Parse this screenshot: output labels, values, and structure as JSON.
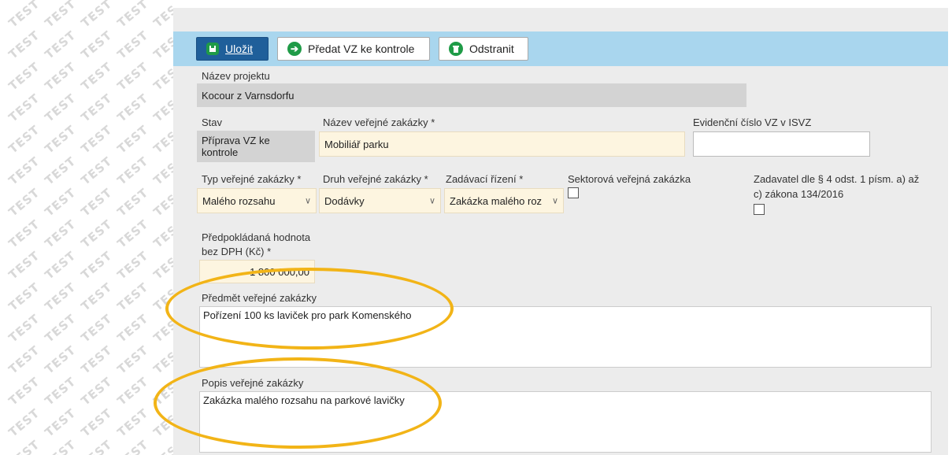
{
  "watermark": {
    "text": "TEST"
  },
  "toolbar": {
    "save_label": "Uložit",
    "submit_label": "Předat VZ ke kontrole",
    "delete_label": "Odstranit"
  },
  "form": {
    "project_name_label": "Název projektu",
    "project_name_value": "Kocour z Varnsdorfu",
    "status_label": "Stav",
    "status_value_line1": "Příprava VZ ke",
    "status_value_line2": "kontrole",
    "contract_name_label": "Název veřejné zakázky *",
    "contract_name_value": "Mobiliář parku",
    "isvz_number_label": "Evidenční číslo VZ v ISVZ",
    "isvz_number_value": "",
    "contract_type_label": "Typ veřejné zakázky *",
    "contract_type_value": "Malého rozsahu",
    "contract_kind_label": "Druh veřejné zakázky *",
    "contract_kind_value": "Dodávky",
    "procedure_label": "Zadávací řízení *",
    "procedure_value": "Zakázka malého roz",
    "sector_label": "Sektorová veřejná zakázka",
    "authority_label_line1": "Zadavatel dle § 4 odst. 1 písm. a) až",
    "authority_label_line2": "c) zákona 134/2016",
    "estimated_value_label_line1": "Předpokládaná hodnota",
    "estimated_value_label_line2": "bez DPH (Kč) *",
    "estimated_value_value": "1 800 000,00",
    "subject_label": "Předmět veřejné zakázky",
    "subject_value": "Pořízení 100 ks laviček pro park Komenského",
    "description_label": "Popis veřejné zakázky",
    "description_value": "Zakázka malého rozsahu na parkové lavičky"
  },
  "colors": {
    "toolbar": "#a9d6ee",
    "primary_button": "#1f5f9a",
    "icon_green": "#1f9b47",
    "highlight": "#f2b417",
    "required_field": "#fdf5e0"
  }
}
